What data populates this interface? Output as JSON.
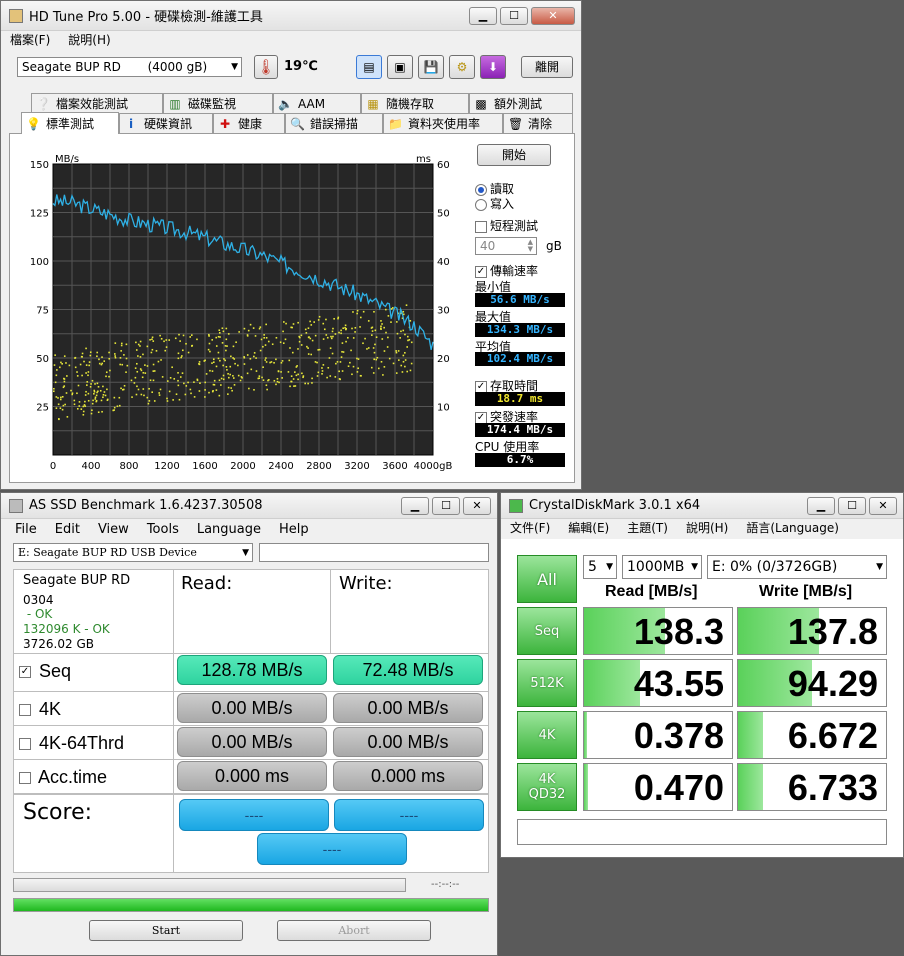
{
  "hdtune": {
    "title": "HD Tune Pro  5.00 - 硬碟檢測-維護工具",
    "menu": [
      "檔案(F)",
      "說明(H)"
    ],
    "drive": "Seagate BUP RD       (4000 gB)",
    "temp": "19℃",
    "exit": "離開",
    "tabs_row1": [
      "檔案效能測試",
      "磁碟監視",
      "AAM",
      "隨機存取",
      "額外測試"
    ],
    "tabs_row2": [
      "標準測試",
      "硬碟資訊",
      "健康",
      "錯誤掃描",
      "資料夾使用率",
      "清除"
    ],
    "start": "開始",
    "read": "讀取",
    "write": "寫入",
    "short_test": "短程測試",
    "short_value": "40",
    "short_unit": "gB",
    "transfer": "傳輸速率",
    "min_label": "最小值",
    "min_value": "56.6 MB/s",
    "max_label": "最大值",
    "max_value": "134.3 MB/s",
    "avg_label": "平均值",
    "avg_value": "102.4 MB/s",
    "access_label": "存取時間",
    "access_value": "18.7 ms",
    "burst_label": "突發速率",
    "burst_value": "174.4 MB/s",
    "cpu_label": "CPU 使用率",
    "cpu_value": "6.7%",
    "colors": {
      "line": "#2fb1e6",
      "scatter": "#e8e83a",
      "plot_bg": "#262626"
    }
  },
  "chart_data": {
    "type": "line",
    "xlabel": "gB",
    "y_left_unit": "MB/s",
    "y_right_unit": "ms",
    "xlim": [
      0,
      4000
    ],
    "ylim_left": [
      0,
      150
    ],
    "ylim_right": [
      0,
      60
    ],
    "x_ticks": [
      "0",
      "400",
      "800",
      "1200",
      "1600",
      "2000",
      "2400",
      "2800",
      "3200",
      "3600",
      "4000gB"
    ],
    "y_left_ticks": [
      "150",
      "125",
      "100",
      "75",
      "50",
      "25"
    ],
    "y_right_ticks": [
      "60",
      "50",
      "40",
      "30",
      "20",
      "10"
    ],
    "series": [
      {
        "x": [
          0,
          200,
          400,
          600,
          800,
          1000,
          1200,
          1400,
          1600,
          1800,
          2000,
          2200,
          2400,
          2600,
          2800,
          3000,
          3200,
          3400,
          3600,
          3800,
          4000
        ],
        "values": [
          131,
          130,
          127,
          124,
          121,
          119,
          117,
          115,
          112,
          109,
          106,
          103,
          99,
          95,
          91,
          87,
          83,
          78,
          73,
          67,
          57
        ]
      },
      {
        "x": [
          0,
          400,
          800,
          1200,
          1600,
          2000,
          2400,
          2800,
          3200,
          3600
        ],
        "values": [
          14,
          15.5,
          17,
          18,
          19,
          20,
          21,
          22,
          23,
          24
        ]
      }
    ]
  },
  "asssd": {
    "title": "AS SSD Benchmark 1.6.4237.30508",
    "menu": [
      "File",
      "Edit",
      "View",
      "Tools",
      "Language",
      "Help"
    ],
    "drive": "E: Seagate BUP RD USB Device",
    "info": [
      "Seagate BUP RD",
      "0304",
      " - OK",
      "132096 K - OK",
      "3726.02 GB"
    ],
    "read_header": "Read:",
    "write_header": "Write:",
    "rows": [
      {
        "label": "Seq",
        "checked": "✓",
        "read": "128.78 MB/s",
        "write": "72.48 MB/s"
      },
      {
        "label": "4K",
        "checked": "",
        "read": "0.00 MB/s",
        "write": "0.00 MB/s"
      },
      {
        "label": "4K-64Thrd",
        "checked": "",
        "read": "0.00 MB/s",
        "write": "0.00 MB/s"
      },
      {
        "label": "Acc.time",
        "checked": "",
        "read": "0.000 ms",
        "write": "0.000 ms"
      }
    ],
    "score_label": "Score:",
    "score_read": "----",
    "score_write": "----",
    "score_total": "----",
    "time": "--:--:--",
    "progress_fill": 1.0,
    "start": "Start",
    "abort": "Abort"
  },
  "cdm": {
    "title": "CrystalDiskMark 3.0.1 x64",
    "menu": [
      "文件(F)",
      "編輯(E)",
      "主題(T)",
      "說明(H)",
      "語言(Language)"
    ],
    "all": "All",
    "runs": "5",
    "size": "1000MB",
    "drive": "E: 0% (0/3726GB)",
    "read_header": "Read [MB/s]",
    "write_header": "Write [MB/s]",
    "rows": [
      {
        "label": "Seq",
        "label2": "",
        "read": "138.3",
        "write": "137.8",
        "read_fill": 0.55,
        "write_fill": 0.55
      },
      {
        "label": "512K",
        "label2": "",
        "read": "43.55",
        "write": "94.29",
        "read_fill": 0.38,
        "write_fill": 0.5
      },
      {
        "label": "4K",
        "label2": "",
        "read": "0.378",
        "write": "6.672",
        "read_fill": 0.02,
        "write_fill": 0.17
      },
      {
        "label": "4K",
        "label2": "QD32",
        "read": "0.470",
        "write": "6.733",
        "read_fill": 0.03,
        "write_fill": 0.17
      }
    ],
    "comment": ""
  }
}
